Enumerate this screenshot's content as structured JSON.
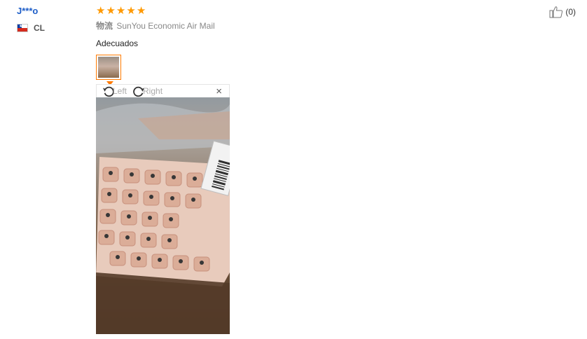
{
  "user": {
    "name": "J***o",
    "country_code": "CL",
    "flag": "chile-flag"
  },
  "review": {
    "rating": 5,
    "stars": [
      "★",
      "★",
      "★",
      "★",
      "★"
    ],
    "shipping_label": "物流",
    "shipping_method": "SunYou Economic Air Mail",
    "comment": "Adecuados"
  },
  "viewer": {
    "rotate_left": "Left",
    "rotate_right": "Right",
    "close": "×"
  },
  "helpful": {
    "count": "(0)"
  },
  "colors": {
    "username": "#1e5ec8",
    "star": "#ff9900",
    "accent": "#ff7a00"
  }
}
